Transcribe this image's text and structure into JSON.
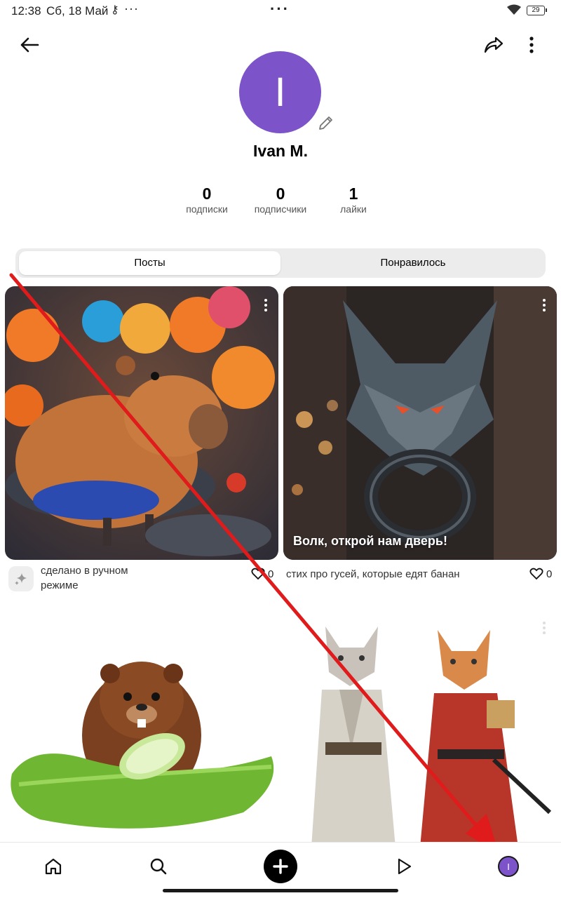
{
  "status_bar": {
    "time": "12:38",
    "date": "Сб, 18 Май",
    "battery": "29"
  },
  "profile": {
    "avatar_letter": "I",
    "avatar_color": "#7c53c9",
    "name": "Ivan M.",
    "stats": [
      {
        "value": "0",
        "label": "подписки"
      },
      {
        "value": "0",
        "label": "подписчики"
      },
      {
        "value": "1",
        "label": "лайки"
      }
    ]
  },
  "tabs": {
    "posts": "Посты",
    "liked": "Понравилось"
  },
  "posts": [
    {
      "subject": "capybara with balloons",
      "overlay_caption": "",
      "description": "сделано в ручном режиме",
      "likes": "0"
    },
    {
      "subject": "wolf door knocker",
      "overlay_caption": "Волк, открой нам дверь!",
      "description": "стих про гусей, которые едят банан",
      "likes": "0"
    },
    {
      "subject": "beaver with cucumber"
    },
    {
      "subject": "samurai cats"
    }
  ],
  "bottom_nav": {
    "avatar_letter": "I"
  },
  "colors": {
    "accent": "#7c53c9",
    "annotation_arrow": "#e01b1b"
  }
}
